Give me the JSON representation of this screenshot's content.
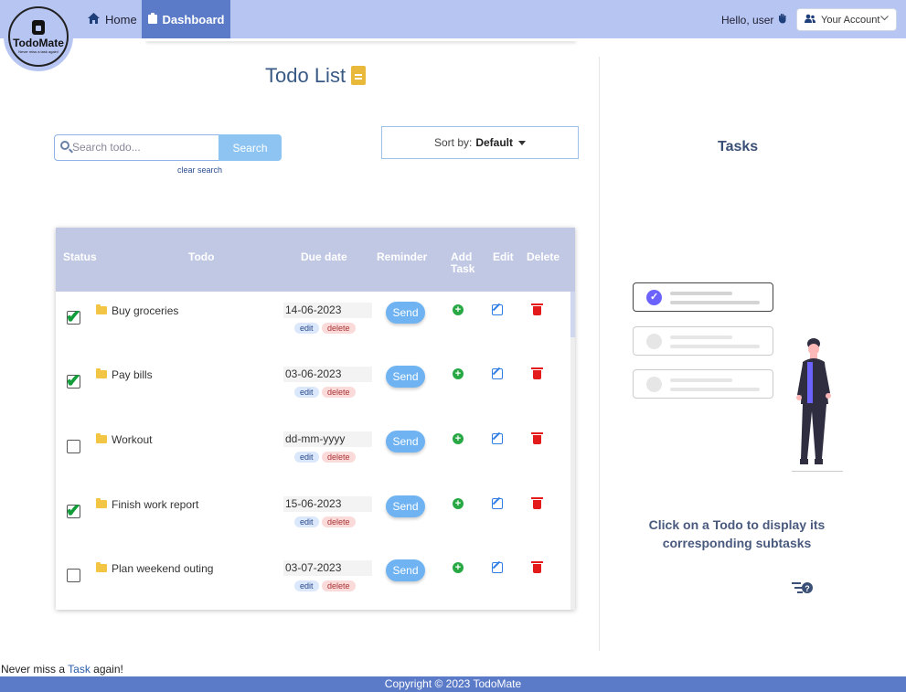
{
  "app": {
    "logo_title": "TodoMate",
    "logo_tagline": "Never miss a task again!"
  },
  "nav": {
    "home": "Home",
    "dashboard": "Dashboard",
    "greeting": "Hello, user",
    "account": "Your Account"
  },
  "main": {
    "title": "Todo List",
    "search_placeholder": "Search todo...",
    "search_button": "Search",
    "clear_search": "clear search",
    "sort_label": "Sort by:",
    "sort_value": "Default"
  },
  "table": {
    "headers": {
      "status": "Status",
      "todo": "Todo",
      "due": "Due date",
      "reminder": "Reminder",
      "add_task_1": "Add",
      "add_task_2": "Task",
      "edit": "Edit",
      "delete": "Delete"
    },
    "edit_label": "edit",
    "delete_label": "delete",
    "send_label": "Send",
    "rows": [
      {
        "todo": "Buy groceries",
        "due": "14-06-2023",
        "done": true
      },
      {
        "todo": "Pay bills",
        "due": "03-06-2023",
        "done": true
      },
      {
        "todo": "Workout",
        "due": "dd-mm-yyyy",
        "done": false
      },
      {
        "todo": "Finish work report",
        "due": "15-06-2023",
        "done": true
      },
      {
        "todo": "Plan weekend outing",
        "due": "03-07-2023",
        "done": false
      }
    ]
  },
  "tasks": {
    "title": "Tasks",
    "hint": "Click on a Todo to display its corresponding subtasks"
  },
  "footer": {
    "tagline_prefix": "Never miss a ",
    "tagline_link": "Task",
    "tagline_suffix": " again!",
    "copyright": "Copyright © 2023 TodoMate"
  },
  "colors": {
    "navbar": "#b7c5f3",
    "active_nav": "#5b7bc8",
    "table_header": "#c1c8e4",
    "check_green": "#129d3a",
    "send_blue": "#6fb3f2",
    "delete_red": "#e31b1b"
  }
}
